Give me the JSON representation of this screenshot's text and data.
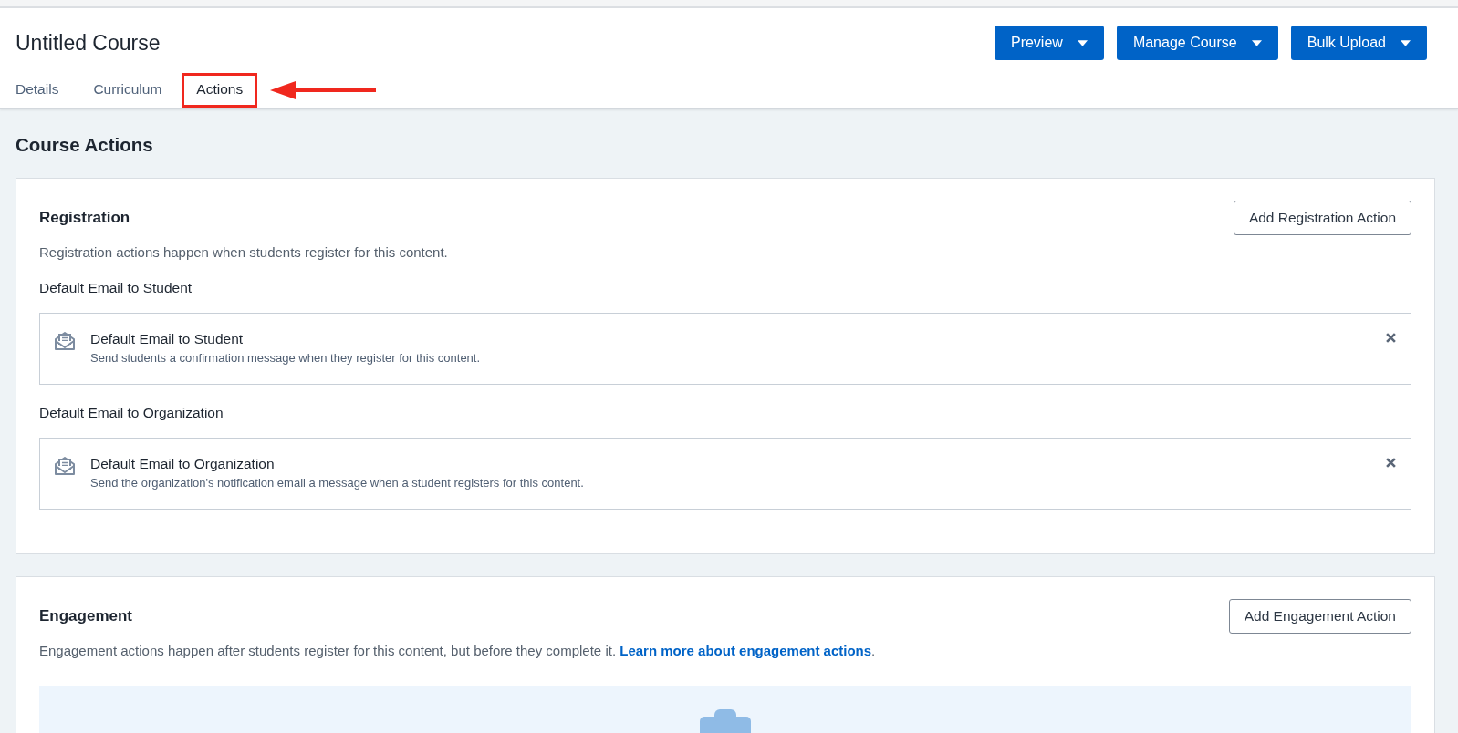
{
  "header": {
    "title": "Untitled Course",
    "buttons": [
      {
        "label": "Preview"
      },
      {
        "label": "Manage Course"
      },
      {
        "label": "Bulk Upload"
      }
    ]
  },
  "tabs": [
    {
      "label": "Details",
      "selected": false,
      "highlighted": false
    },
    {
      "label": "Curriculum",
      "selected": false,
      "highlighted": false
    },
    {
      "label": "Actions",
      "selected": true,
      "highlighted": true
    }
  ],
  "page_title": "Course Actions",
  "sections": [
    {
      "kind": "list",
      "title": "Registration",
      "button": "Add Registration Action",
      "description": "Registration actions happen when students register for this content.",
      "groups": [
        {
          "heading": "Default Email to Student",
          "action": {
            "title": "Default Email to Student",
            "description": "Send students a confirmation message when they register for this content."
          }
        },
        {
          "heading": "Default Email to Organization",
          "action": {
            "title": "Default Email to Organization",
            "description": "Send the organization's notification email a message when a student registers for this content."
          }
        }
      ]
    },
    {
      "kind": "empty",
      "title": "Engagement",
      "button": "Add Engagement Action",
      "description": "Engagement actions happen after students register for this content, but before they complete it.",
      "link": "Learn more about engagement actions",
      "description_end": "."
    }
  ]
}
